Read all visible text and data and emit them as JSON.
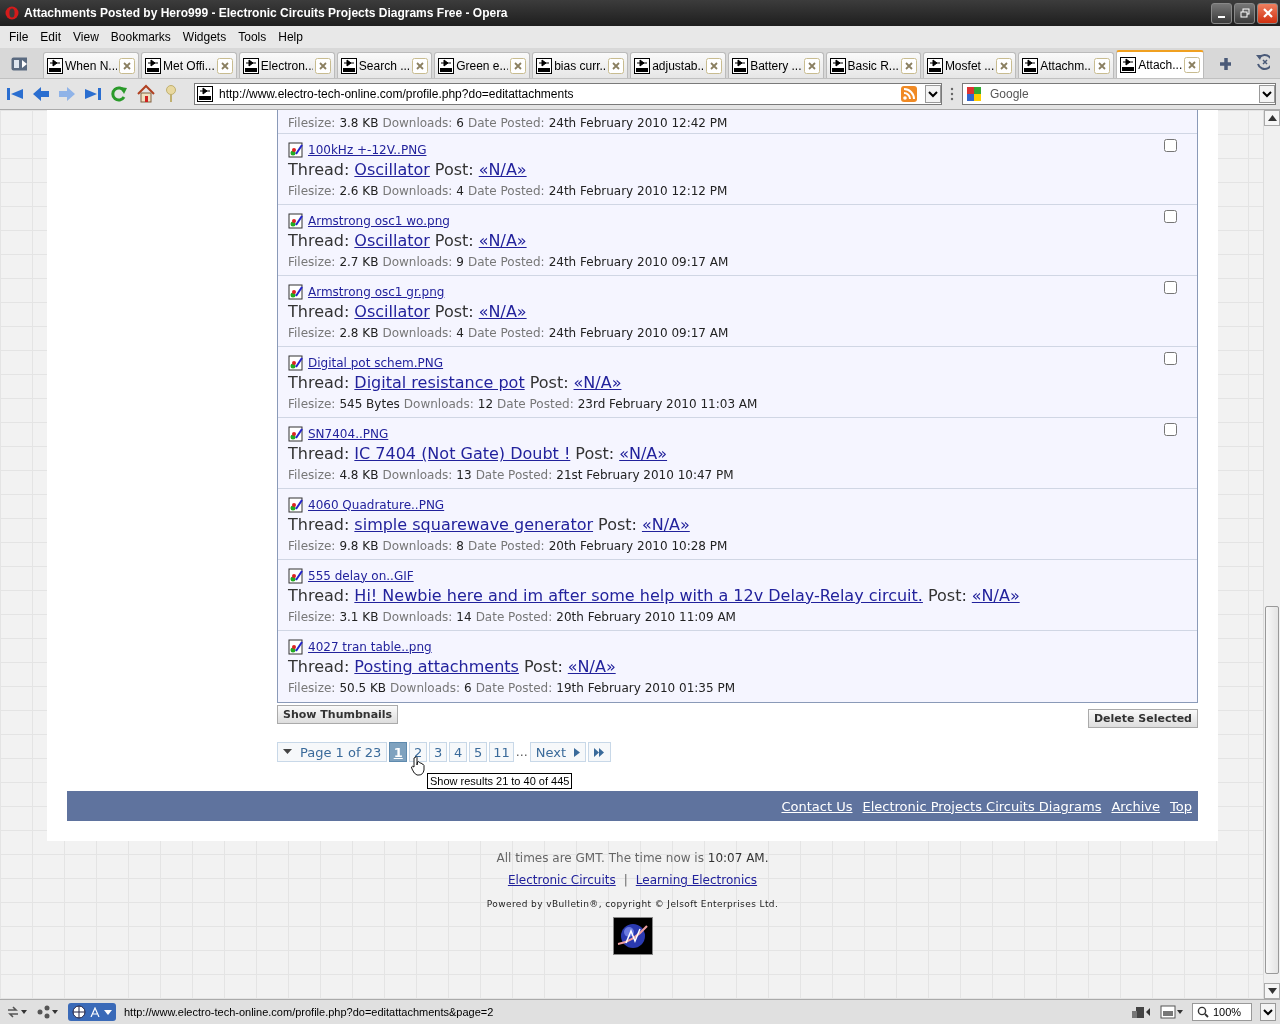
{
  "window": {
    "title": "Attachments Posted by Hero999 - Electronic Circuits Projects Diagrams Free - Opera"
  },
  "menu": [
    {
      "label": "File"
    },
    {
      "label": "Edit"
    },
    {
      "label": "View"
    },
    {
      "label": "Bookmarks"
    },
    {
      "label": "Widgets"
    },
    {
      "label": "Tools"
    },
    {
      "label": "Help"
    }
  ],
  "tabs": [
    {
      "label": "When N...",
      "selected": false
    },
    {
      "label": "Met Offi...",
      "selected": false
    },
    {
      "label": "Electron...",
      "selected": false
    },
    {
      "label": "Search ...",
      "selected": false
    },
    {
      "label": "Green e...",
      "selected": false
    },
    {
      "label": "bias curr...",
      "selected": false
    },
    {
      "label": "adjustab...",
      "selected": false
    },
    {
      "label": "Battery ...",
      "selected": false
    },
    {
      "label": "Basic R...",
      "selected": false
    },
    {
      "label": "Mosfet ...",
      "selected": false
    },
    {
      "label": "Attachm...",
      "selected": false
    },
    {
      "label": "Attach...",
      "selected": true
    }
  ],
  "address_bar": {
    "value": "http://www.electro-tech-online.com/profile.php?do=editattachments"
  },
  "search": {
    "placeholder": "Google"
  },
  "attachments": [
    {
      "kind": "plain",
      "filesize_label": "Filesize:",
      "filesize": "3.8 KB",
      "downloads_label": "Downloads:",
      "downloads": "6",
      "date_label": "Date Posted:",
      "date": "24th February 2010 12:42 PM"
    },
    {
      "kind": "checkbox",
      "checked": false,
      "filename": "100kHz +-12V..PNG",
      "thread_label": "Thread:",
      "thread": "Oscillator",
      "post_label": "Post:",
      "post": "«N/A»",
      "filesize_label": "Filesize:",
      "filesize": "2.6 KB",
      "downloads_label": "Downloads:",
      "downloads": "4",
      "date_label": "Date Posted:",
      "date": "24th February 2010 12:12 PM"
    },
    {
      "kind": "checkbox",
      "checked": false,
      "filename": "Armstrong osc1 wo.png",
      "thread_label": "Thread:",
      "thread": "Oscillator",
      "post_label": "Post:",
      "post": "«N/A»",
      "filesize_label": "Filesize:",
      "filesize": "2.7 KB",
      "downloads_label": "Downloads:",
      "downloads": "9",
      "date_label": "Date Posted:",
      "date": "24th February 2010 09:17 AM"
    },
    {
      "kind": "checkbox",
      "checked": false,
      "filename": "Armstrong osc1 gr.png",
      "thread_label": "Thread:",
      "thread": "Oscillator",
      "post_label": "Post:",
      "post": "«N/A»",
      "filesize_label": "Filesize:",
      "filesize": "2.8 KB",
      "downloads_label": "Downloads:",
      "downloads": "4",
      "date_label": "Date Posted:",
      "date": "24th February 2010 09:17 AM"
    },
    {
      "kind": "checkbox",
      "checked": false,
      "filename": "Digital pot schem.PNG",
      "thread_label": "Thread:",
      "thread": "Digital resistance pot",
      "post_label": "Post:",
      "post": "«N/A»",
      "filesize_label": "Filesize:",
      "filesize": "545 Bytes",
      "downloads_label": "Downloads:",
      "downloads": "12",
      "date_label": "Date Posted:",
      "date": "23rd February 2010 11:03 AM"
    },
    {
      "kind": "checkbox",
      "checked": false,
      "filename": "SN7404..PNG",
      "thread_label": "Thread:",
      "thread": "IC 7404 (Not Gate) Doubt !",
      "post_label": "Post:",
      "post": "«N/A»",
      "filesize_label": "Filesize:",
      "filesize": "4.8 KB",
      "downloads_label": "Downloads:",
      "downloads": "13",
      "date_label": "Date Posted:",
      "date": "21st February 2010 10:47 PM"
    },
    {
      "kind": "plain",
      "filename": "4060 Quadrature..PNG",
      "thread_label": "Thread:",
      "thread": "simple squarewave generator",
      "post_label": "Post:",
      "post": "«N/A»",
      "filesize_label": "Filesize:",
      "filesize": "9.8 KB",
      "downloads_label": "Downloads:",
      "downloads": "8",
      "date_label": "Date Posted:",
      "date": "20th February 2010 10:28 PM"
    },
    {
      "kind": "plain",
      "filename": "555 delay on..GIF",
      "thread_label": "Thread:",
      "thread": "Hi! Newbie here and im after some help with a 12v Delay-Relay circuit.",
      "post_label": "Post:",
      "post": "«N/A»",
      "filesize_label": "Filesize:",
      "filesize": "3.1 KB",
      "downloads_label": "Downloads:",
      "downloads": "14",
      "date_label": "Date Posted:",
      "date": "20th February 2010 11:09 AM"
    },
    {
      "kind": "plain",
      "filename": "4027 tran table..png",
      "thread_label": "Thread:",
      "thread": "Posting attachments",
      "post_label": "Post:",
      "post": "«N/A»",
      "filesize_label": "Filesize:",
      "filesize": "50.5 KB",
      "downloads_label": "Downloads:",
      "downloads": "6",
      "date_label": "Date Posted:",
      "date": "19th February 2010 01:35 PM"
    }
  ],
  "buttons": {
    "show_thumbnails": "Show Thumbnails",
    "delete_selected": "Delete Selected"
  },
  "pagination": {
    "summary": "Page 1 of 23",
    "pages": [
      {
        "label": "1",
        "selected": true
      },
      {
        "label": "2",
        "selected": false
      },
      {
        "label": "3",
        "selected": false
      },
      {
        "label": "4",
        "selected": false
      },
      {
        "label": "5",
        "selected": false
      },
      {
        "label": "11",
        "selected": false
      }
    ],
    "ellipsis": "…",
    "next": "Next"
  },
  "tooltip": "Show results 21 to 40 of 445",
  "footer_links": [
    "Contact Us",
    "Electronic Projects Circuits Diagrams",
    "Archive",
    "Top"
  ],
  "time_note": "All times are GMT. The time now is",
  "time": "10:07 AM.",
  "bottom_links": [
    "Electronic Circuits",
    "Learning Electronics"
  ],
  "bottom_separator": "|",
  "powered_by": "Powered by vBulletin®, copyright © Jelsoft Enterprises Ltd.",
  "status_bar": {
    "url": "http://www.electro-tech-online.com/profile.php?do=editattachments&page=2",
    "zoom": "100%"
  }
}
